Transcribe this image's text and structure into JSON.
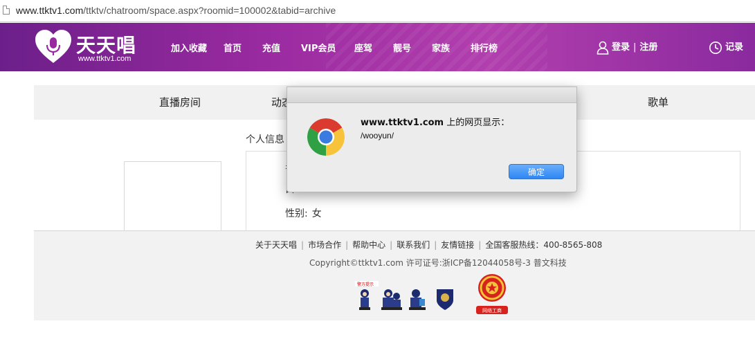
{
  "browser": {
    "url_domain": "www.ttktv1.com",
    "url_path": "/ttktv/chatroom/space.aspx?roomid=100002&tabid=archive"
  },
  "header": {
    "logo_text": "天天唱",
    "logo_sub": "www.ttktv1.com",
    "nav": [
      "加入收藏",
      "首页",
      "充值",
      "VIP会员",
      "座驾",
      "靓号",
      "家族",
      "排行榜"
    ],
    "login": "登录",
    "login_sep": "|",
    "register": "注册",
    "record": "记录"
  },
  "tabs": [
    "直播房间",
    "动态",
    "歌单"
  ],
  "profile": {
    "section_title": "个人信息",
    "rows": [
      {
        "label": "身",
        "value": ""
      },
      {
        "label": "白",
        "value": ""
      },
      {
        "label": "性别:",
        "value": "女"
      }
    ]
  },
  "footer": {
    "links": [
      "关于天天唱",
      "市场合作",
      "帮助中心",
      "联系我们",
      "友情链接",
      "全国客服热线：400-8565-808"
    ],
    "copyright": "Copyright©ttktv1.com 许可证号:浙ICP备12044058号-3 普文科技",
    "badge_top_label": "警方提示",
    "emblem_label": "网络工商"
  },
  "dialog": {
    "title_domain": "www.ttktv1.com",
    "title_suffix": " 上的网页显示：",
    "message": "/wooyun/",
    "ok_label": "确定"
  },
  "colors": {
    "header_purple": "#9a2aa0",
    "button_blue": "#2f86f3"
  },
  "icons": [
    "page-icon",
    "heart-mic-logo-icon",
    "user-icon",
    "clock-icon",
    "chrome-logo-icon"
  ]
}
